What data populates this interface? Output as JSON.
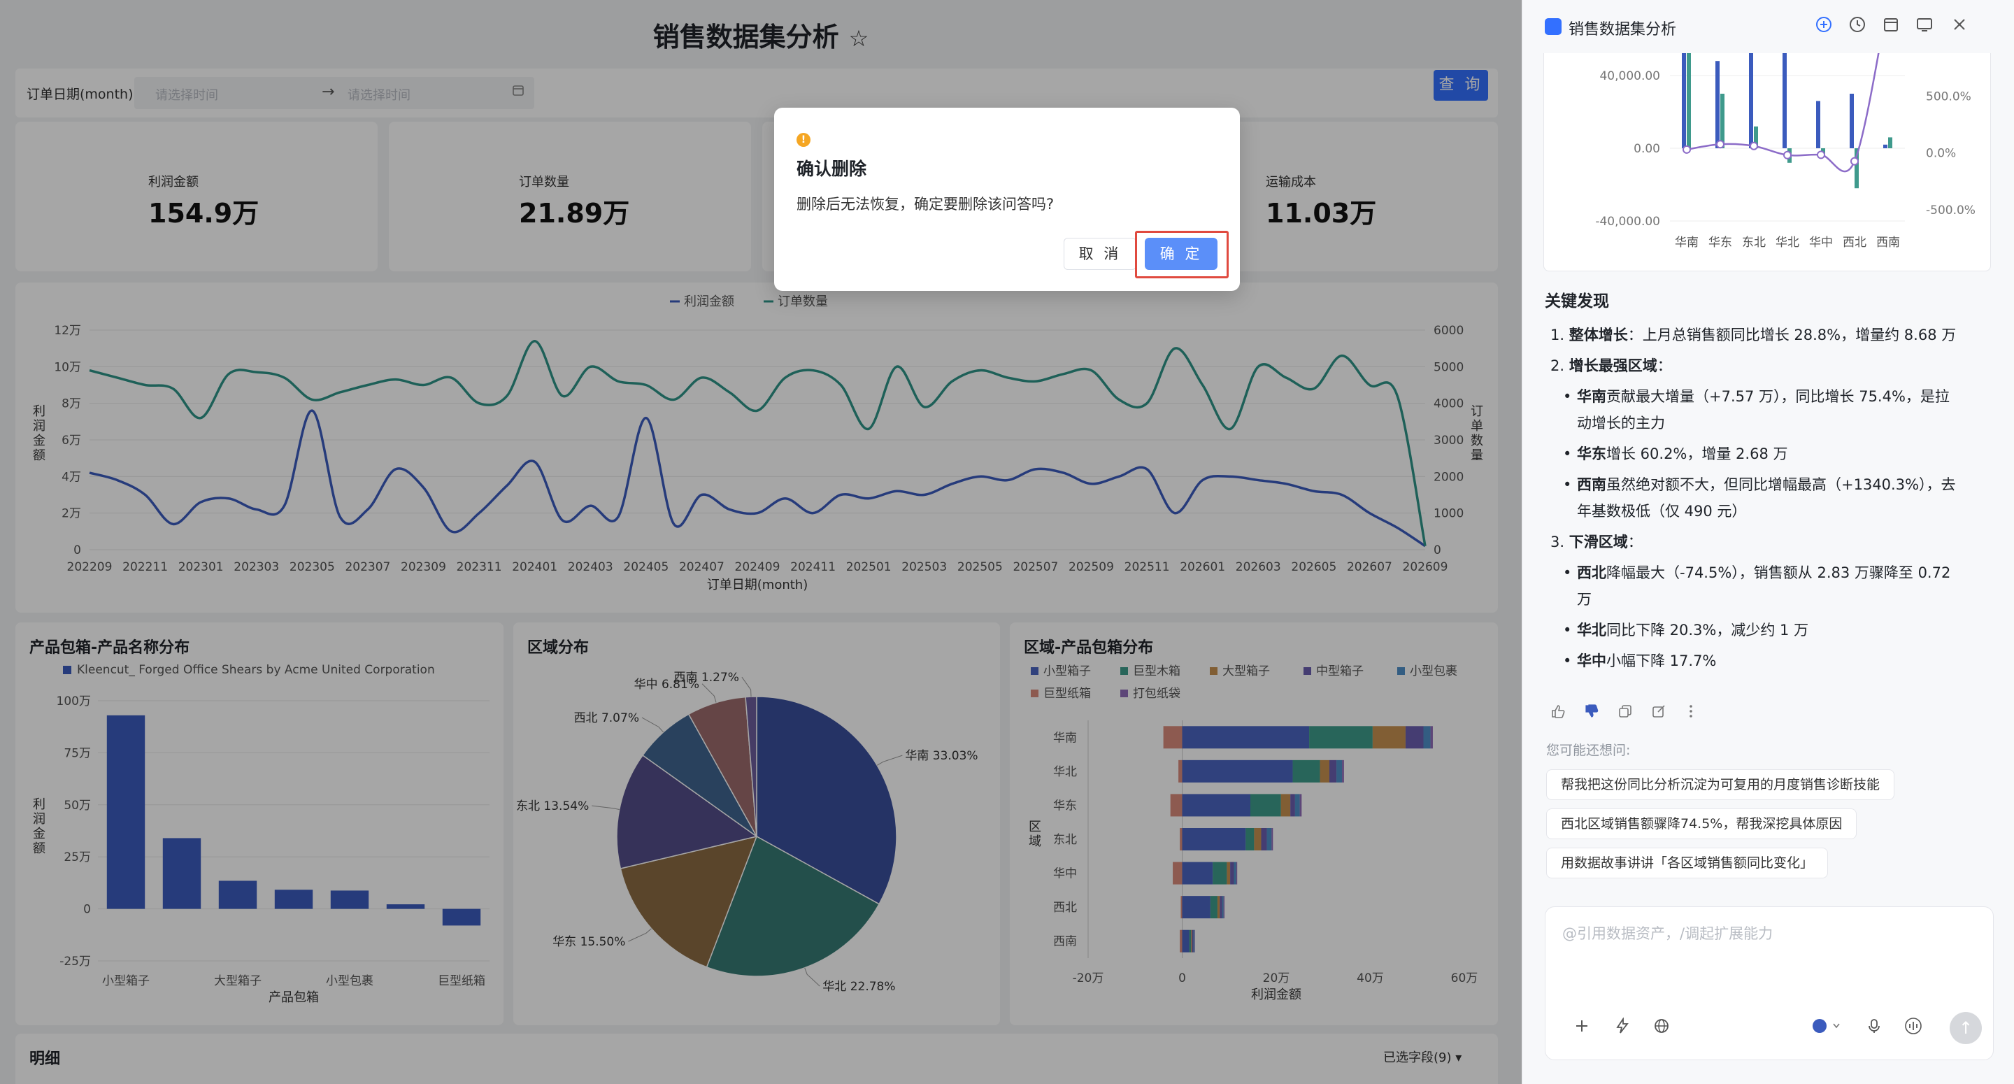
{
  "dashboard": {
    "title": "销售数据集分析",
    "star_icon": "☆",
    "filter": {
      "label": "订单日期(month)",
      "start_placeholder": "请选择时间",
      "end_placeholder": "请选择时间",
      "arrow": "→",
      "query_label": "查 询"
    },
    "kpis": [
      {
        "label": "利润金额",
        "value": "154.9万"
      },
      {
        "label": "订单数量",
        "value": "21.89万"
      },
      {
        "label": "运输成本",
        "value": "11.03万"
      }
    ],
    "detail_title": "明细",
    "detail_fields": "已选字段(9)"
  },
  "colors": {
    "accent": "#3370ff",
    "series_blue": "#3b5bbd",
    "series_teal": "#2f9488",
    "overlay": "rgba(0,0,0,0.35)"
  },
  "chart_data": [
    {
      "type": "line",
      "xlabel": "订单日期(month)",
      "ylabel": "利润金额",
      "y2label": "订单数量",
      "legend": "top-center",
      "ylim": [
        0,
        120000
      ],
      "y2lim": [
        0,
        6000
      ],
      "yticks": [
        "0",
        "2万",
        "4万",
        "6万",
        "8万",
        "10万",
        "12万"
      ],
      "y2ticks": [
        "0",
        "1000",
        "2000",
        "3000",
        "4000",
        "5000",
        "6000"
      ],
      "categories": [
        "202209",
        "202210",
        "202211",
        "202212",
        "202301",
        "202302",
        "202303",
        "202304",
        "202305",
        "202306",
        "202307",
        "202308",
        "202309",
        "202310",
        "202311",
        "202312",
        "202401",
        "202402",
        "202403",
        "202404",
        "202405",
        "202406",
        "202407",
        "202408",
        "202409",
        "202410",
        "202411",
        "202412",
        "202501",
        "202502",
        "202503",
        "202504",
        "202505",
        "202506",
        "202507",
        "202508",
        "202509",
        "202510",
        "202511",
        "202512",
        "202601",
        "202602",
        "202603",
        "202604",
        "202605",
        "202606",
        "202607",
        "202608",
        "202609"
      ],
      "tick_labels": [
        "202209",
        "202211",
        "202301",
        "202303",
        "202305",
        "202307",
        "202309",
        "202311",
        "202401",
        "202403",
        "202405",
        "202407",
        "202409",
        "202411",
        "202501",
        "202503",
        "202505",
        "202507",
        "202509",
        "202511",
        "202601",
        "202603",
        "202605",
        "202607",
        "202609"
      ],
      "series": [
        {
          "name": "利润金额",
          "axis": "left",
          "color": "#3b5bbd",
          "values": [
            42000,
            38000,
            30000,
            14000,
            26000,
            28000,
            22000,
            24000,
            76000,
            18000,
            22000,
            44000,
            34000,
            10000,
            20000,
            35000,
            48000,
            16000,
            24000,
            18000,
            72000,
            14000,
            30000,
            22000,
            20000,
            28000,
            20000,
            30000,
            28000,
            32000,
            30000,
            36000,
            40000,
            38000,
            44000,
            42000,
            36000,
            40000,
            44000,
            20000,
            38000,
            40000,
            38000,
            36000,
            32000,
            30000,
            20000,
            12000,
            2000
          ]
        },
        {
          "name": "订单数量",
          "axis": "right",
          "color": "#2f9488",
          "values": [
            4900,
            4700,
            4500,
            4400,
            3600,
            4800,
            4850,
            4700,
            4100,
            4300,
            4500,
            4650,
            4500,
            4700,
            4000,
            4200,
            5700,
            4200,
            5000,
            4600,
            4500,
            4100,
            4700,
            4300,
            3800,
            4700,
            4900,
            4500,
            3300,
            5000,
            3900,
            4600,
            4900,
            4700,
            4600,
            4800,
            4900,
            4100,
            4000,
            5500,
            4500,
            3300,
            5000,
            4700,
            4400,
            5300,
            4500,
            4200,
            100
          ]
        }
      ]
    },
    {
      "type": "bar",
      "title": "产品包箱-产品名称分布",
      "legend_label": "Kleencut_ Forged Office Shears by Acme United Corporation",
      "xlabel": "产品包箱",
      "ylabel": "利润金额",
      "ylim": [
        -250000,
        1000000
      ],
      "yticks": [
        "-25万",
        "0",
        "25万",
        "50万",
        "75万",
        "100万"
      ],
      "categories": [
        "小型箱子",
        "中型箱子",
        "大型箱子",
        "巨型木箱",
        "小型包裹",
        "打包纸袋",
        "巨型纸箱"
      ],
      "tick_labels": [
        "小型箱子",
        "大型箱子",
        "小型包裹",
        "巨型纸箱"
      ],
      "values": [
        930000,
        340000,
        135000,
        92000,
        88000,
        22000,
        -80000
      ]
    },
    {
      "type": "pie",
      "title": "区域分布",
      "categories": [
        "华南",
        "华北",
        "华东",
        "东北",
        "西北",
        "华中",
        "西南"
      ],
      "labels": [
        "华南 33.03%",
        "华北 22.78%",
        "华东 15.50%",
        "东北 13.54%",
        "西北 7.07%",
        "华中 6.81%",
        "西南 1.27%"
      ],
      "values": [
        33.03,
        22.78,
        15.5,
        13.54,
        7.07,
        6.81,
        1.27
      ],
      "colors": [
        "#3a4f9c",
        "#377a74",
        "#8a6b42",
        "#544e89",
        "#3f6590",
        "#9c6b6c",
        "#6c5c9b"
      ]
    },
    {
      "type": "bar",
      "orientation": "horizontal",
      "stacked": true,
      "title": "区域-产品包箱分布",
      "xlabel": "利润金额",
      "ylabel": "区域",
      "xlim": [
        -200000,
        600000
      ],
      "xticks": [
        "-20万",
        "0",
        "20万",
        "40万",
        "60万"
      ],
      "categories": [
        "华南",
        "华北",
        "华东",
        "东北",
        "华中",
        "西北",
        "西南"
      ],
      "series": [
        {
          "name": "小型箱子",
          "color": "#4a64c0",
          "values": [
            270000,
            235000,
            145000,
            135000,
            65000,
            60000,
            15000
          ]
        },
        {
          "name": "巨型木箱",
          "color": "#3e9b8a",
          "values": [
            135000,
            58000,
            65000,
            18000,
            30000,
            15000,
            4000
          ]
        },
        {
          "name": "大型箱子",
          "color": "#c69150",
          "values": [
            70000,
            20000,
            20000,
            15000,
            7000,
            5000,
            2000
          ]
        },
        {
          "name": "中型箱子",
          "color": "#6a5fb0",
          "values": [
            38000,
            15000,
            10000,
            12000,
            8000,
            5000,
            3000
          ]
        },
        {
          "name": "小型包裹",
          "color": "#4f90c8",
          "values": [
            15000,
            12000,
            10000,
            10000,
            5000,
            3000,
            2000
          ]
        },
        {
          "name": "巨型纸箱",
          "color": "#d98a7c",
          "values": [
            -40000,
            -8000,
            -25000,
            -5000,
            -20000,
            -3000,
            -5000
          ]
        },
        {
          "name": "打包纸袋",
          "color": "#8f6cb8",
          "values": [
            5000,
            4000,
            4000,
            3000,
            2000,
            2000,
            1000
          ]
        }
      ]
    },
    {
      "type": "bar",
      "title": "",
      "ylim": [
        -40000,
        60000
      ],
      "y2lim": [
        -600,
        1000
      ],
      "yticks": [
        "-40,000.00",
        "0.00",
        "40,000.00"
      ],
      "y2ticks": [
        "-500.0%",
        "0.0%",
        "500.0%"
      ],
      "categories": [
        "华南",
        "华东",
        "东北",
        "华北",
        "华中",
        "西北",
        "西南"
      ],
      "series": [
        {
          "name": "",
          "color": "#3b5bbd",
          "values": [
            80000,
            48000,
            60000,
            55000,
            26000,
            30000,
            2000
          ]
        },
        {
          "name": "",
          "color": "#3f9a8c",
          "values": [
            72000,
            30000,
            12000,
            -8000,
            -3000,
            -22000,
            6000
          ]
        },
        {
          "name": "",
          "color": "#8c6cc8",
          "type": "line",
          "values": [
            28.8,
            75.4,
            60.2,
            -20.3,
            -17.7,
            -74.5,
            1340.3
          ]
        }
      ]
    }
  ],
  "dialog": {
    "warn_icon": "!",
    "title": "确认删除",
    "message": "删除后无法恢复，确定要删除该问答吗?",
    "cancel_label": "取 消",
    "ok_label": "确 定"
  },
  "panel": {
    "title": "销售数据集分析",
    "findings_title": "关键发现",
    "items": [
      {
        "num": "1.",
        "bold": "整体增长",
        "text": "：上月总销售额同比增长 28.8%，增量约 8.68 万"
      },
      {
        "num": "2.",
        "bold": "增长最强区域",
        "text": "："
      },
      {
        "num": "3.",
        "bold": "下滑区域",
        "text": "："
      }
    ],
    "growth_bullets": [
      {
        "bold": "华南",
        "line1": "贡献最大增量（+7.57 万），同比增长 75.4%，是拉",
        "line2": "动增长的主力"
      },
      {
        "bold": "华东",
        "line1": "增长 60.2%，增量 2.68 万",
        "line2": ""
      },
      {
        "bold": "西南",
        "line1": "虽然绝对额不大，但同比增幅最高（+1340.3%），去",
        "line2": "年基数极低（仅 490 元）"
      }
    ],
    "decline_bullets": [
      {
        "bold": "西北",
        "line1": "降幅最大（-74.5%），销售额从 2.83 万骤降至 0.72",
        "line2": "万"
      },
      {
        "bold": "华北",
        "line1": "同比下降 20.3%，减少约 1 万",
        "line2": ""
      },
      {
        "bold": "华中",
        "line1": "小幅下降 17.7%",
        "line2": ""
      }
    ],
    "suggest_title": "您可能还想问:",
    "suggestions": [
      "帮我把这份同比分析沉淀为可复用的月度销售诊断技能",
      "西北区域销售额骤降74.5%，帮我深挖具体原因",
      "用数据故事讲讲「各区域销售额同比变化」"
    ],
    "input_placeholder": "@引用数据资产，/调起扩展能力"
  }
}
